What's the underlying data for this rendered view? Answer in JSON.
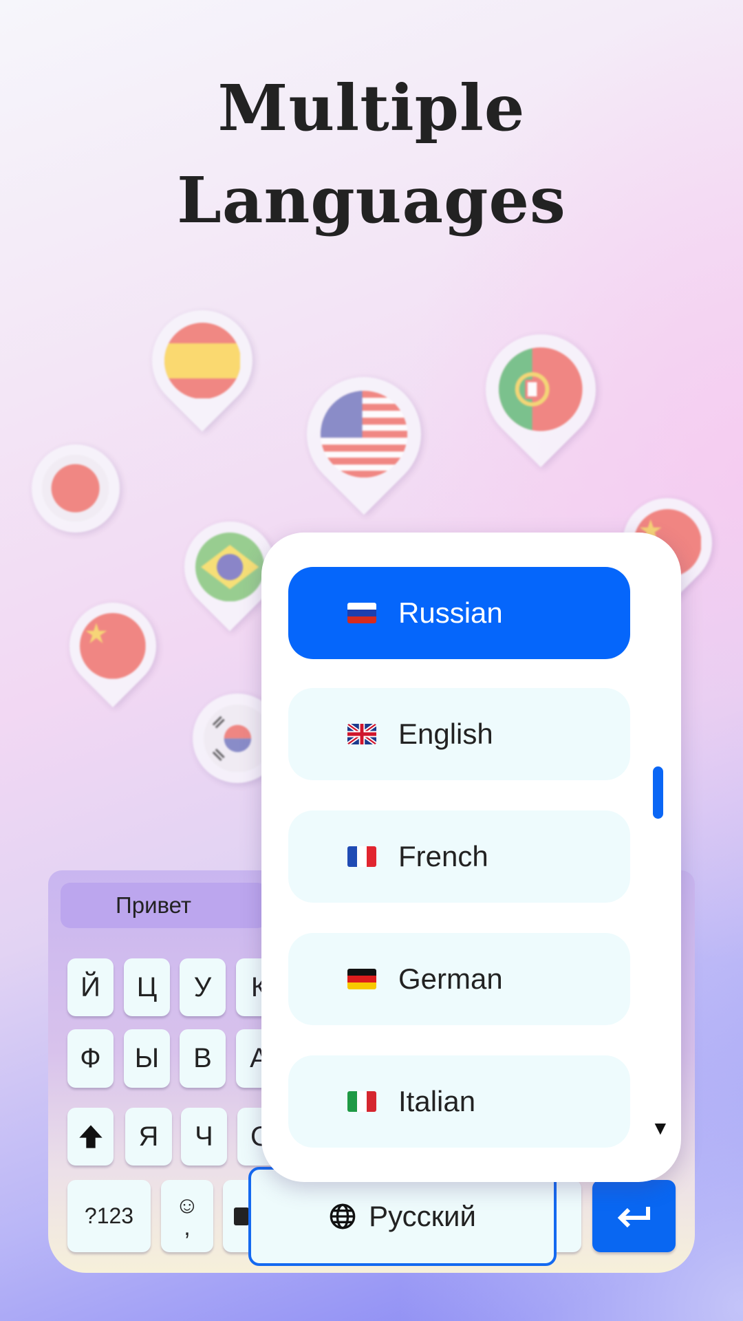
{
  "title": {
    "line1": "Multiple",
    "line2": "Languages"
  },
  "background_flags": [
    "spain",
    "usa",
    "portugal",
    "japan",
    "brazil",
    "china",
    "korea",
    "china"
  ],
  "keyboard": {
    "suggestion": "Привет",
    "row1": [
      "Й",
      "Ц",
      "У",
      "К"
    ],
    "row2": [
      "Ф",
      "Ы",
      "В",
      "А"
    ],
    "row3": [
      "Я",
      "Ч",
      "С"
    ],
    "symbols_key": "?123",
    "emoji_key": "☺",
    "comma": ",",
    "space_label": "Русский",
    "icons": {
      "shift": "shift-arrow-icon",
      "globe": "globe-icon",
      "enter": "enter-arrow-icon",
      "keyboard": "keyboard-icon"
    }
  },
  "language_menu": {
    "selected": "Russian",
    "items": [
      {
        "label": "Russian",
        "flag": "ru"
      },
      {
        "label": "English",
        "flag": "gb"
      },
      {
        "label": "French",
        "flag": "fr"
      },
      {
        "label": "German",
        "flag": "de"
      },
      {
        "label": "Italian",
        "flag": "it"
      }
    ],
    "more_indicator": "▼"
  },
  "colors": {
    "accent": "#0566fb",
    "item_bg": "#eefbfd",
    "key_bg": "#eefbfc"
  }
}
